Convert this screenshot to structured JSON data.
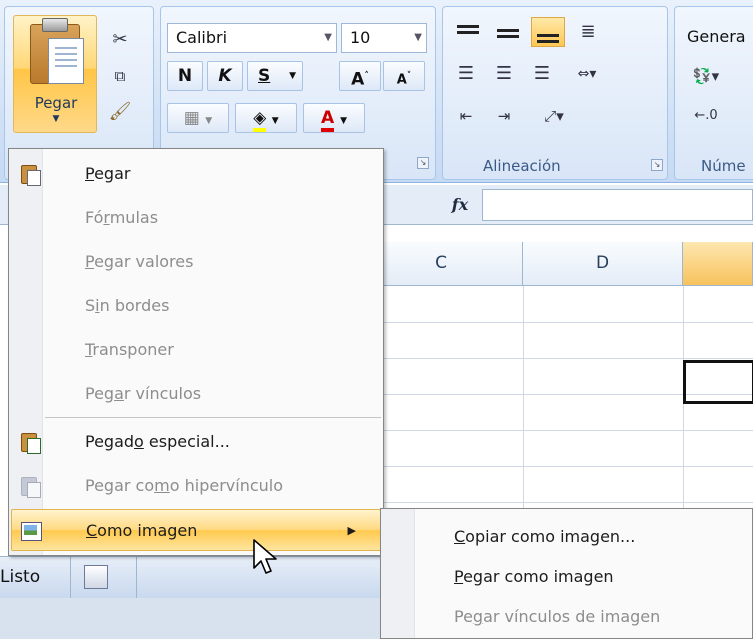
{
  "ribbon": {
    "clipboard": {
      "paste_label": "Pegar"
    },
    "font": {
      "name": "Calibri",
      "size": "10",
      "bold": "N",
      "italic": "K",
      "underline": "S",
      "grow": "A",
      "shrink": "A",
      "color_letter": "A"
    },
    "alignment": {
      "label": "Alineación"
    },
    "number": {
      "format": "Genera",
      "label": "Núme"
    }
  },
  "formula_bar": {
    "fx_label": "fx"
  },
  "columns": [
    "C",
    "D"
  ],
  "status": {
    "ready": "Listo"
  },
  "paste_menu": {
    "items": [
      {
        "pre": "",
        "ul": "P",
        "post": "egar",
        "enabled": true
      },
      {
        "pre": "Fó",
        "ul": "r",
        "post": "mulas",
        "enabled": false
      },
      {
        "pre": "",
        "ul": "P",
        "post": "egar valores",
        "enabled": false
      },
      {
        "pre": "S",
        "ul": "i",
        "post": "n bordes",
        "enabled": false
      },
      {
        "pre": "",
        "ul": "T",
        "post": "ransponer",
        "enabled": false
      },
      {
        "pre": "Peg",
        "ul": "a",
        "post": "r vínculos",
        "enabled": false
      },
      {
        "pre": "Pegad",
        "ul": "o",
        "post": " especial...",
        "enabled": true
      },
      {
        "pre": "Pegar co",
        "ul": "m",
        "post": "o hipervínculo",
        "enabled": false
      },
      {
        "pre": "",
        "ul": "C",
        "post": "omo imagen",
        "enabled": true
      }
    ]
  },
  "as_picture_submenu": {
    "items": [
      {
        "pre": "",
        "ul": "C",
        "post": "opiar como imagen...",
        "enabled": true
      },
      {
        "pre": "",
        "ul": "P",
        "post": "egar como imagen",
        "enabled": true
      },
      {
        "pre": "Pe",
        "ul": "g",
        "post": "ar vínculos de imagen",
        "enabled": false
      }
    ]
  },
  "colors": {
    "hover_gold": "#ffd980",
    "disabled_text": "#8d8d8d",
    "ribbon_blue": "#d4e3f6"
  }
}
